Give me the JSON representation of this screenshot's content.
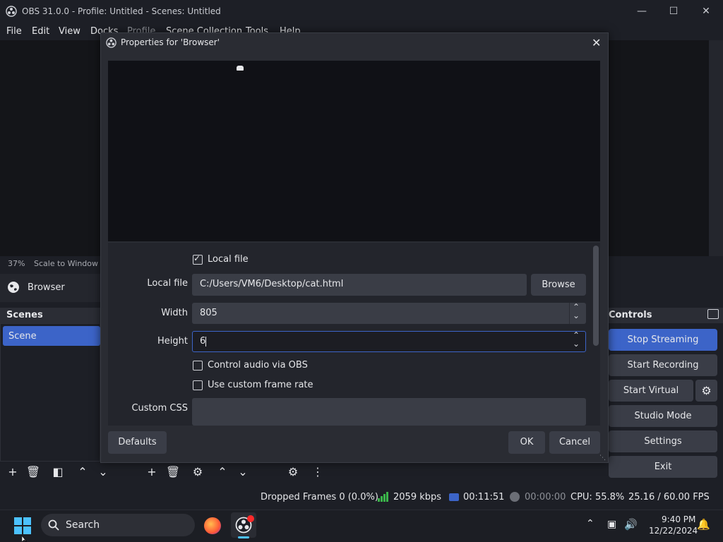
{
  "window": {
    "title": "OBS 31.0.0 - Profile: Untitled - Scenes: Untitled"
  },
  "menu": [
    "File",
    "Edit",
    "View",
    "Docks",
    "Profile",
    "Scene Collection",
    "Tools",
    "Help"
  ],
  "preview": {
    "zoom": "37%",
    "scale_label": "Scale to Window"
  },
  "source": {
    "name": "Browser"
  },
  "scenes": {
    "title": "Scenes",
    "items": [
      "Scene"
    ]
  },
  "controls": {
    "title": "Controls",
    "stop_streaming": "Stop Streaming",
    "start_recording": "Start Recording",
    "virtual_camera": "Start Virtual Camera",
    "studio_mode": "Studio Mode",
    "settings": "Settings",
    "exit": "Exit"
  },
  "dialog": {
    "title": "Properties for 'Browser'",
    "local_file_checkbox": "Local file",
    "local_file_label": "Local file",
    "local_file_value": "C:/Users/VM6/Desktop/cat.html",
    "browse": "Browse",
    "width_label": "Width",
    "width_value": "805",
    "height_label": "Height",
    "height_value": "6",
    "control_audio": "Control audio via OBS",
    "custom_frame_rate": "Use custom frame rate",
    "custom_css_label": "Custom CSS",
    "defaults": "Defaults",
    "ok": "OK",
    "cancel": "Cancel"
  },
  "status": {
    "dropped_frames": "Dropped Frames 0 (0.0%)",
    "bitrate": "2059 kbps",
    "stream_time": "00:11:51",
    "record_time": "00:00:00",
    "cpu": "CPU: 55.8%",
    "fps": "25.16 / 60.00 FPS"
  },
  "taskbar": {
    "search_placeholder": "Search",
    "time": "9:40 PM",
    "date": "12/22/2024"
  },
  "colors": {
    "accent": "#3c64c8",
    "bitrate_ok": "#3ab54a"
  }
}
